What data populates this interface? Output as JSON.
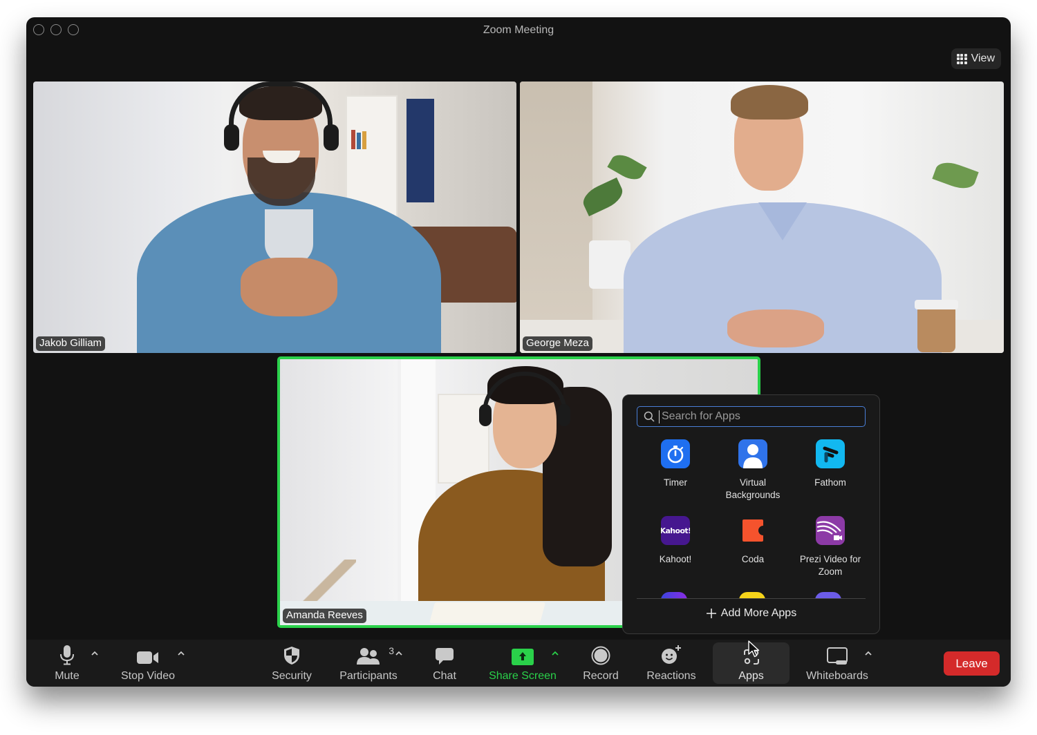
{
  "window": {
    "title": "Zoom Meeting",
    "view_button_label": "View"
  },
  "participants": [
    {
      "name": "Jakob Gilliam",
      "active_speaker": false
    },
    {
      "name": "George Meza",
      "active_speaker": false
    },
    {
      "name": "Amanda Reeves",
      "active_speaker": true
    }
  ],
  "apps_panel": {
    "search_placeholder": "Search for Apps",
    "search_value": "",
    "apps": [
      {
        "label": "Timer",
        "icon": "stopwatch-icon",
        "color": "#1f6ff0"
      },
      {
        "label": "Virtual Backgrounds",
        "icon": "person-icon",
        "color": "#2f73ea"
      },
      {
        "label": "Fathom",
        "icon": "fathom-icon",
        "color": "#12b8f0"
      },
      {
        "label": "Kahoot!",
        "icon": "kahoot-icon",
        "color": "#46178f"
      },
      {
        "label": "Coda",
        "icon": "coda-icon",
        "color": "#f5532d"
      },
      {
        "label": "Prezi Video for Zoom",
        "icon": "prezi-icon",
        "color": "#8c3aa6"
      }
    ],
    "add_more_label": "Add More Apps"
  },
  "toolbar": {
    "mute_label": "Mute",
    "stop_video_label": "Stop Video",
    "security_label": "Security",
    "participants_label": "Participants",
    "participants_count": "3",
    "chat_label": "Chat",
    "share_screen_label": "Share Screen",
    "record_label": "Record",
    "reactions_label": "Reactions",
    "apps_label": "Apps",
    "whiteboards_label": "Whiteboards",
    "leave_label": "Leave"
  },
  "colors": {
    "accent_green": "#2ad14a",
    "leave_red": "#d42a2a",
    "search_focus": "#4a7fd8"
  }
}
